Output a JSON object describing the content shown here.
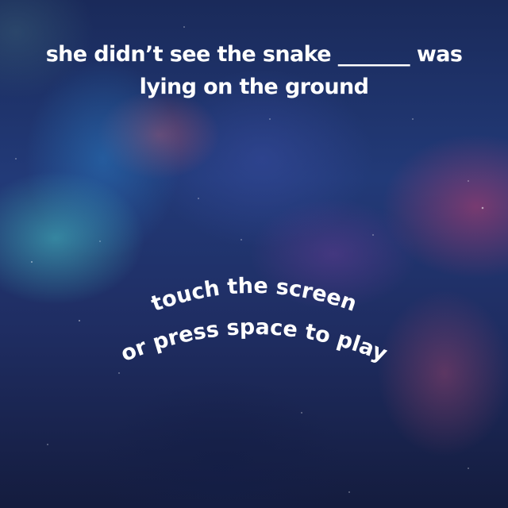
{
  "question": {
    "line1": "she didn’t see the snake _______ was",
    "line2": "lying on the ground"
  },
  "start_prompt": {
    "line1": "touch the screen",
    "line2": "or press space to play"
  },
  "colors": {
    "text": "#ffffff",
    "background": "#223a78"
  }
}
